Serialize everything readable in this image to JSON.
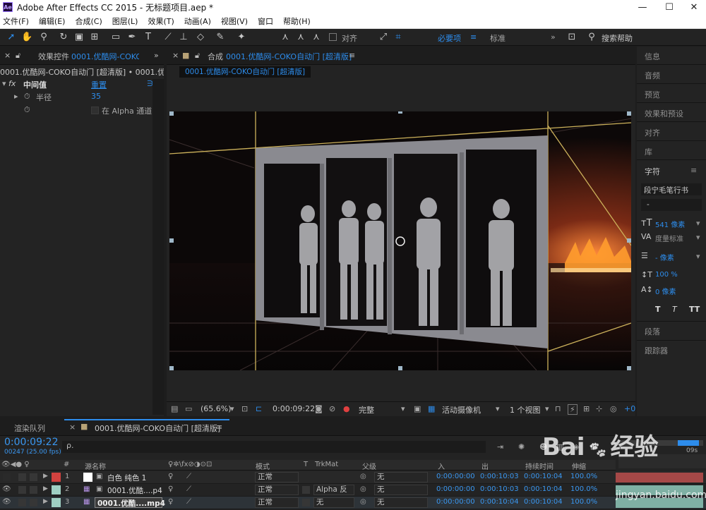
{
  "window": {
    "title": "Adobe After Effects CC 2015 - 无标题项目.aep *",
    "app_icon_text": "Ae",
    "minimize": "—",
    "maximize": "☐",
    "close": "✕"
  },
  "menu": [
    "文件(F)",
    "编辑(E)",
    "合成(C)",
    "图层(L)",
    "效果(T)",
    "动画(A)",
    "视图(V)",
    "窗口",
    "帮助(H)"
  ],
  "toolbar": {
    "snap_label": "对齐",
    "workspace_essentials": "必要项",
    "workspace_standard": "标准",
    "search_help": "搜索帮助",
    "more": "»",
    "menu_glyph": "≡"
  },
  "effects_panel": {
    "tab_label": "效果控件",
    "tab_comp": "0001.优酷网-COKO自",
    "breadcrumb": "0001.优酷网-COKO自动门 [超清版] • 0001.优酷网",
    "effect_name": "中间值",
    "effect_reset": "重置",
    "effect_about": "∋",
    "prop_radius_label": "半径",
    "prop_radius_value": "35",
    "prop_alpha_label": "在 Alpha 通道"
  },
  "comp_panel": {
    "tab_label": "合成",
    "tab_comp": "0001.优酷网-COKO自动门 [超清版]",
    "sub_tab": "0001.优酷网-COKO自动门 [超清版]",
    "menu_glyph": "≡"
  },
  "viewer_bar": {
    "zoom": "(65.6%)",
    "timecode": "0:00:09:22",
    "resolution": "完整",
    "camera": "活动摄像机",
    "views": "1 个视图",
    "offset": "+0"
  },
  "right_panel": {
    "items": [
      "信息",
      "音频",
      "预览",
      "效果和预设",
      "对齐",
      "库"
    ],
    "char_tab": "字符",
    "font_name": "段宁毛笔行书",
    "font_style": "-",
    "font_size": "541 像素",
    "tracking_label": "度量标准",
    "leading": "- 像素",
    "vscale": "100 %",
    "baseline": "0 像素",
    "style_buttons": [
      "T",
      "T",
      "TT"
    ],
    "paragraph": "段落",
    "tracker": "跟踪器",
    "menu_glyph": "≡"
  },
  "timeline": {
    "render_queue_tab": "渲染队列",
    "comp_tab": "0001.优酷网-COKO自动门 [超清版]",
    "current_time": "0:00:09:22",
    "frame_info": "00247 (25.00 fps)",
    "search_placeholder": "ρ.",
    "ruler_end": "09s",
    "headers": {
      "num": "#",
      "source": "源名称",
      "mode": "模式",
      "t": "T",
      "trkmat": "TrkMat",
      "parent": "父级",
      "in": "入",
      "out": "出",
      "duration": "持续时间",
      "stretch": "伸缩"
    },
    "layers": [
      {
        "num": "1",
        "label_color": "#d2423f",
        "name": "白色 纯色 1",
        "mode": "",
        "trkmat": "",
        "parent": "无",
        "in": "0:00:00:00",
        "out": "0:00:10:03",
        "duration": "0:00:10:04",
        "stretch": "100.0%"
      },
      {
        "num": "2",
        "label_color": "#9fd0c3",
        "name": "0001.优酷....p4",
        "mode": "正常",
        "trkmat": "Alpha 反",
        "parent": "无",
        "in": "0:00:00:00",
        "out": "0:00:10:03",
        "duration": "0:00:10:04",
        "stretch": "100.0%"
      },
      {
        "num": "3",
        "label_color": "#9fd0c3",
        "name": "0001.优酷....mp4",
        "mode": "正常",
        "trkmat": "无",
        "parent": "无",
        "in": "0:00:00:00",
        "out": "0:00:10:04",
        "duration": "0:00:10:04",
        "stretch": "100.0%"
      }
    ],
    "layer1_mode": "正常"
  },
  "watermark": {
    "logo_text": "Bai",
    "logo_text2": "经验",
    "url": "jingyan.baidu.com"
  },
  "colors": {
    "accent": "#2d8ceb",
    "timecode": "#3a97f0",
    "layer_red": "#d2423f",
    "layer_aqua": "#9fd0c3"
  }
}
